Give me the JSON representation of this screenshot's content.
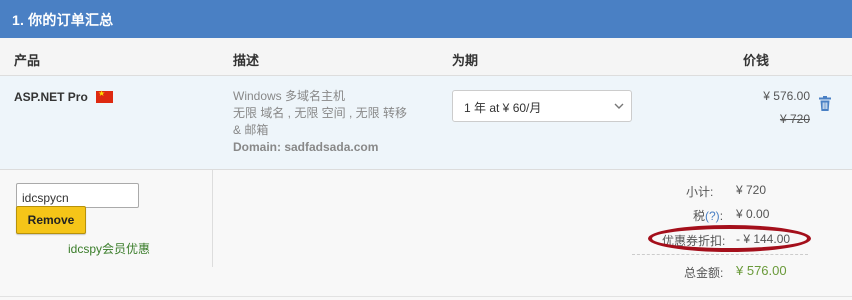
{
  "header": {
    "title": "1.  你的订单汇总"
  },
  "columns": {
    "product": "产品",
    "description": "描述",
    "period": "为期",
    "price": "价钱"
  },
  "product": {
    "name": "ASP.NET Pro",
    "flag_icon": "china-flag-icon",
    "description_lines": [
      "Windows 多域名主机",
      "无限 域名 , 无限 空间 , 无限 转移",
      "& 邮箱"
    ],
    "domain": "Domain: sadfadsada.com",
    "period_selected": "1 年 at ¥ 60/月",
    "price": "¥ 576.00",
    "original_price": "¥ 720"
  },
  "promo": {
    "code": "idcspycn",
    "remove_label": "Remove",
    "name": "idcspy会员优惠"
  },
  "totals": {
    "subtotal_label": "小计:",
    "subtotal_value": "¥ 720",
    "tax_label": "税",
    "tax_link": "(?)",
    "tax_colon": ":",
    "tax_value": "¥ 0.00",
    "discount_label": "优惠券折扣:",
    "discount_value": "- ¥ 144.00",
    "total_label": "总金额:",
    "total_value": "¥ 576.00"
  },
  "colors": {
    "header_bg": "#4a80c4",
    "highlight_ellipse": "#a40f1b",
    "total_green": "#6a9a3a",
    "remove_yellow": "#f5c518"
  }
}
